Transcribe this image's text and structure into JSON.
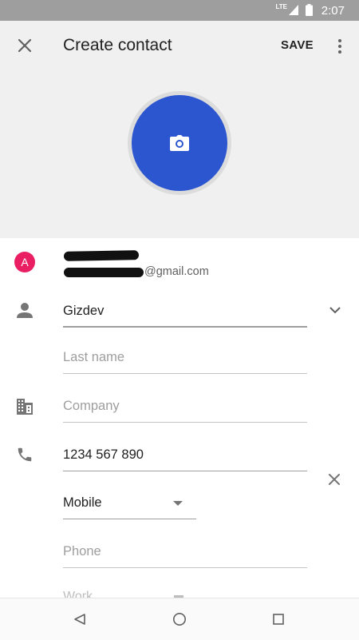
{
  "status_bar": {
    "time": "2:07",
    "network": "LTE"
  },
  "app_bar": {
    "title": "Create contact",
    "save_label": "SAVE"
  },
  "account": {
    "avatar_letter": "A",
    "email_suffix": "@gmail.com"
  },
  "fields": {
    "first_name": {
      "value": "Gizdev"
    },
    "last_name": {
      "placeholder": "Last name"
    },
    "company": {
      "placeholder": "Company"
    },
    "phone": {
      "value": "1234 567 890",
      "type": "Mobile"
    },
    "phone2": {
      "placeholder": "Phone",
      "type": "Work"
    }
  },
  "icons": {
    "close": "close-icon",
    "more": "more-vert-icon",
    "camera": "camera-icon",
    "person": "person-icon",
    "company": "business-icon",
    "phone": "phone-icon",
    "expand": "chevron-down-icon",
    "remove": "close-icon",
    "back": "nav-back-icon",
    "home": "nav-home-icon",
    "recents": "nav-recents-icon"
  },
  "colors": {
    "accent": "#2c56cf",
    "avatar": "#e91e63",
    "header_bg": "#f0f0f0",
    "status_bar": "#9e9e9e"
  }
}
